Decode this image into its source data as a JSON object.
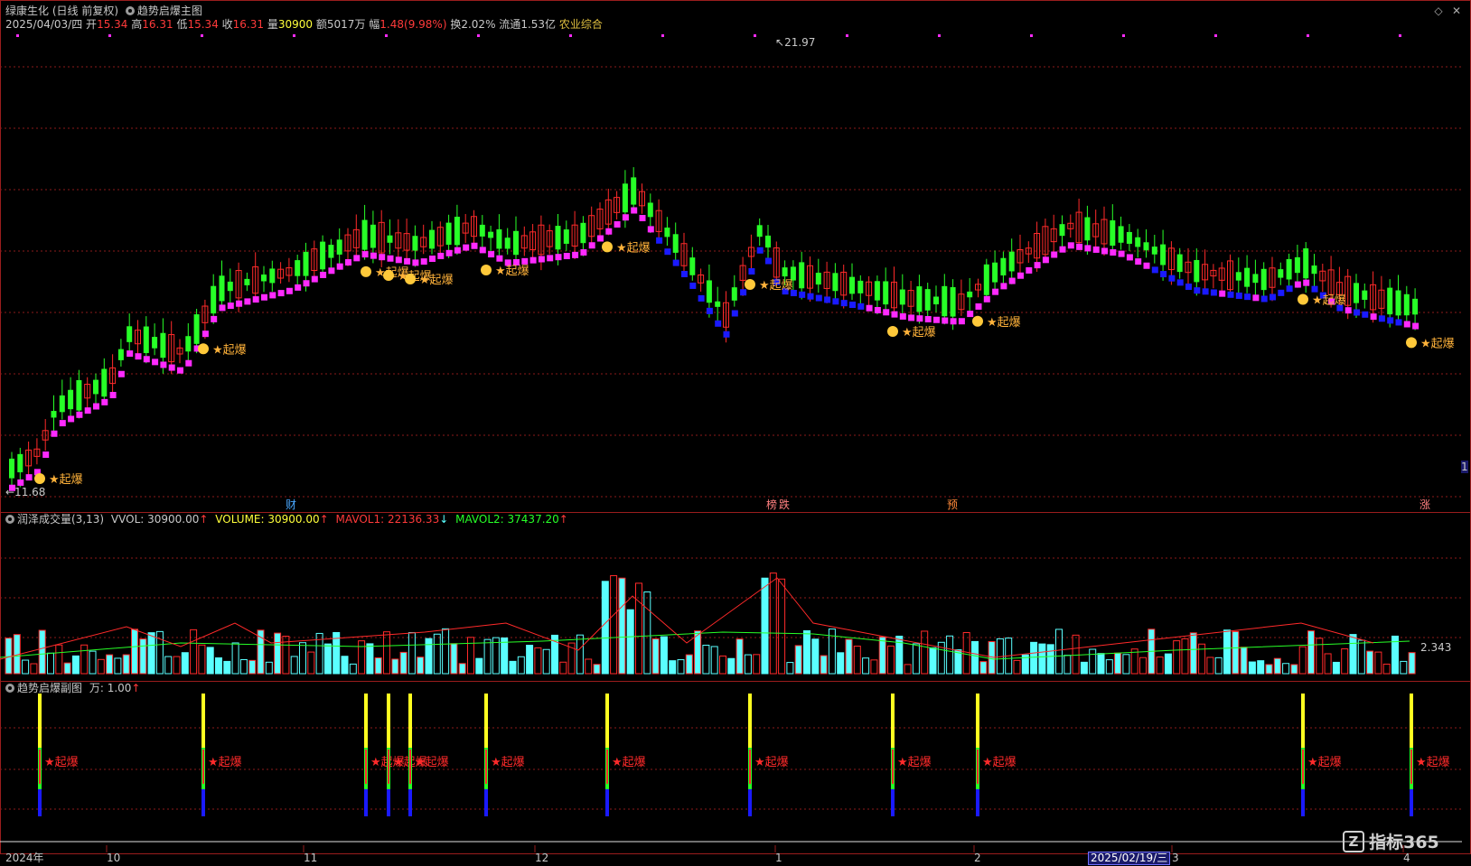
{
  "title_bar": {
    "stock": "绿康生化",
    "period": "(日线 前复权)",
    "indicator": "趋势启爆主图"
  },
  "quote": {
    "date": "2025/04/03/四",
    "open_label": "开",
    "open": "15.34",
    "high_label": "高",
    "high": "16.31",
    "low_label": "低",
    "low": "15.34",
    "close_label": "收",
    "close": "16.31",
    "volume_label": "量",
    "volume": "30900",
    "amount_label": "额",
    "amount": "5017万",
    "change_label": "幅",
    "change": "1.48(9.98%)",
    "turnover_label": "换",
    "turnover": "2.02%",
    "float_label": "流通",
    "float": "1.53亿",
    "sector": "农业综合"
  },
  "main_chart": {
    "high_marker": "21.97",
    "low_marker": "←11.68",
    "signal_label": "★起爆",
    "event_markers": [
      {
        "text": "财",
        "color": "#4aa8ff"
      },
      {
        "text": "榜",
        "color": "#ff8080"
      },
      {
        "text": "跌",
        "color": "#ff8080"
      },
      {
        "text": "预",
        "color": "#ff8a3a"
      },
      {
        "text": "涨",
        "color": "#ff8080"
      }
    ],
    "right_edge_value": "1"
  },
  "volume_panel": {
    "name": "润泽成交量(3,13)",
    "vvol_label": "VVOL: 30900.00",
    "volume_label": "VOLUME: 30900.00",
    "mavol1_label": "MAVOL1: 22136.33",
    "mavol2_label": "MAVOL2: 37437.20",
    "right_value": "2.343"
  },
  "sub_panel": {
    "name": "趋势启爆副图",
    "unit_label": "万: 1.00",
    "signal_label": "★起爆"
  },
  "time_axis": {
    "labels": [
      "2024年",
      "10",
      "11",
      "12",
      "1",
      "2",
      "3",
      "4"
    ],
    "crosshair_date": "2025/02/19/三"
  },
  "watermark": "指标365",
  "colors": {
    "up": "#ff2a2a",
    "down": "#27ff27",
    "trend_up": "#ff2aff",
    "trend_down": "#1a1aff",
    "volume": "#5affff",
    "signal": "#ffb23a",
    "grid": "#8b1a1a"
  }
}
